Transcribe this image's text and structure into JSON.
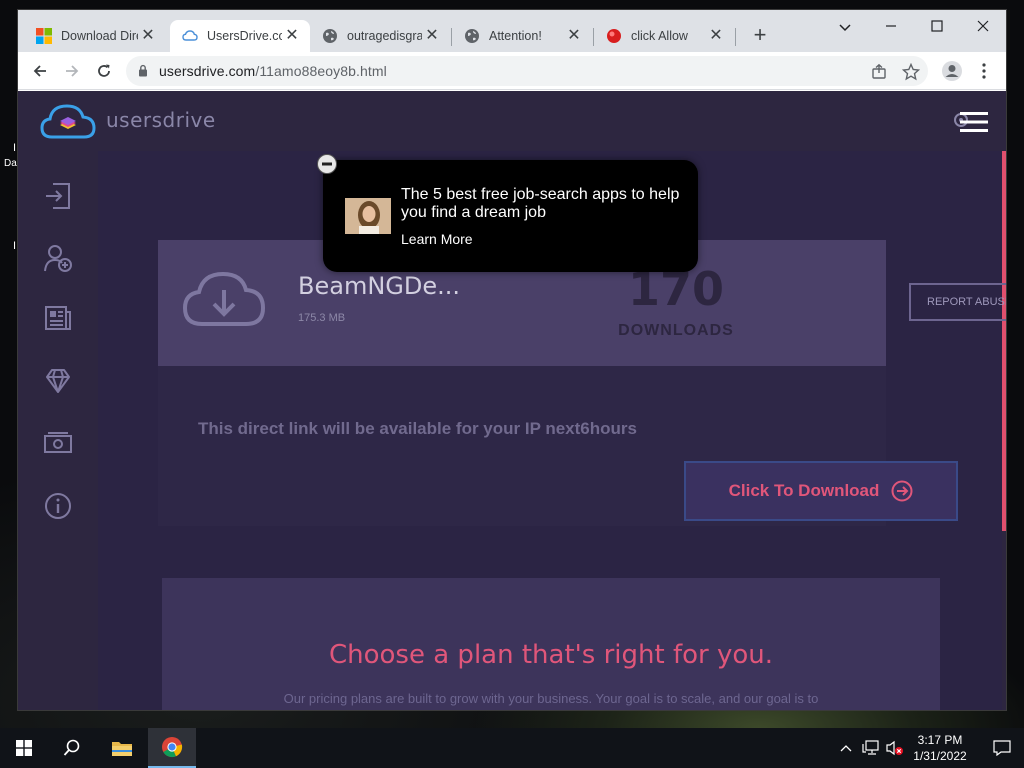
{
  "browser": {
    "tabs": [
      {
        "label": "Download Dire",
        "icon": "windows-logo-icon"
      },
      {
        "label": "UsersDrive.com",
        "icon": "usersdrive-cloud-icon",
        "active": true
      },
      {
        "label": "outragedisgra",
        "icon": "globe-icon"
      },
      {
        "label": "Attention!",
        "icon": "globe-icon"
      },
      {
        "label": "click Allow",
        "icon": "red-dot-icon"
      }
    ],
    "tab_close_glyph": "✕",
    "new_tab_glyph": "+",
    "url_domain": "usersdrive.com",
    "url_path": "/11amo88eoy8b.html"
  },
  "site": {
    "logo_text": "usersdrive",
    "sidebar_icons": [
      "sign-in-icon",
      "add-user-icon",
      "news-icon",
      "diamond-icon",
      "money-icon",
      "info-icon"
    ],
    "file": {
      "name": "BeamNGDe...",
      "size": "175.3 MB",
      "downloads_count": "170",
      "downloads_label": "DOWNLOADS"
    },
    "report_label": "REPORT ABUSE",
    "direct_link_text": "This direct link will be available for your IP next6hours",
    "download_button_label": "Click To Download",
    "plan_title": "Choose a plan that's right for you.",
    "plan_subtitle": "Our pricing plans are built to grow with your business. Your goal is to scale, and our goal is to"
  },
  "ad": {
    "title": "The 5 best free job-search apps to help you find a dream job",
    "cta": "Learn More"
  },
  "desktop": {
    "fragments": [
      "I",
      "Da",
      "I"
    ]
  },
  "taskbar": {
    "time": "3:17 PM",
    "date": "1/31/2022"
  },
  "colors": {
    "accent_pink": "#e0567a",
    "page_bg": "#2d2640",
    "card_bg": "#4a4068"
  }
}
